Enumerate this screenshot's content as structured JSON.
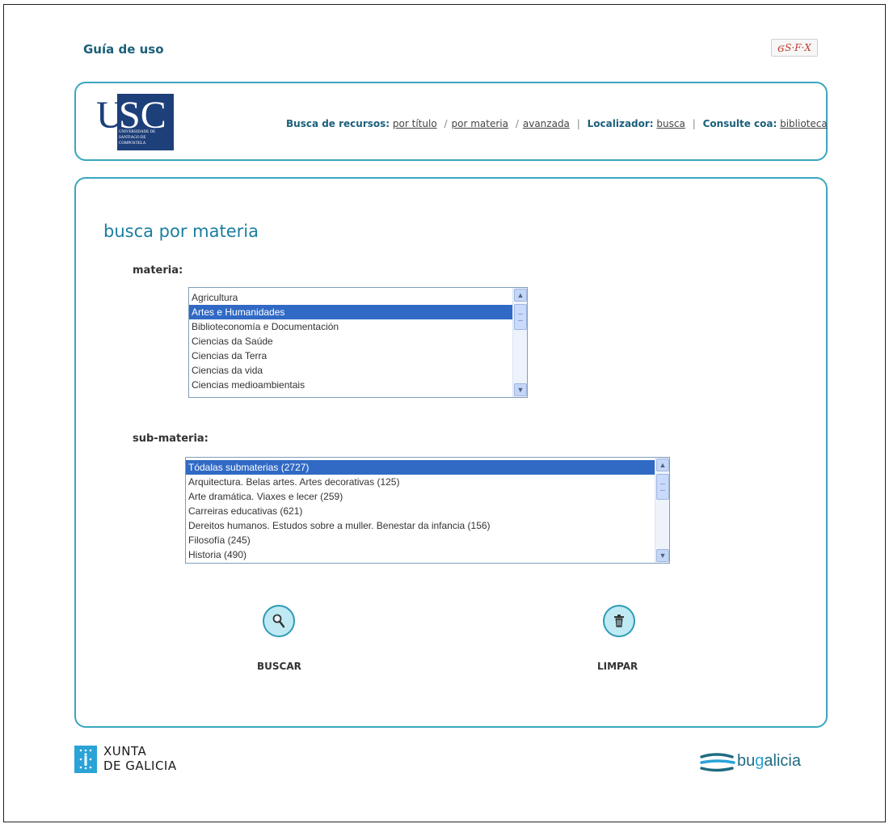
{
  "top": {
    "guide_label": "Guía de uso",
    "sfx_label": "S·F·X"
  },
  "header": {
    "logo_letters": "USC",
    "logo_subtext": "UNIVERSIDADE DE SANTIAGO DE COMPOSTELA",
    "nav": {
      "resources_label": "Busca de recursos:",
      "by_title": "por título",
      "by_subject": "por materia",
      "advanced": "avanzada",
      "locator_label": "Localizador:",
      "locator_link": "busca",
      "consult_label": "Consulte coa:",
      "library_link": "biblioteca",
      "slash": "/",
      "pipe": "|"
    }
  },
  "main": {
    "title": "busca por materia",
    "subject_label": "materia:",
    "subject_items": [
      "Agricultura",
      "Artes e Humanidades",
      "Biblioteconomía e Documentación",
      "Ciencias da Saúde",
      "Ciencias da Terra",
      "Ciencias da vida",
      "Ciencias medioambientais"
    ],
    "subject_selected": "Artes e Humanidades",
    "subsubject_label": "sub-materia:",
    "subsubject_items": [
      "Tódalas submaterias (2727)",
      "Arquitectura. Belas artes. Artes decorativas (125)",
      "Arte dramática. Viaxes e lecer (259)",
      "Carreiras educativas (621)",
      "Dereitos humanos. Estudos sobre a muller. Benestar da infancia (156)",
      "Filosofía (245)",
      "Historia (490)"
    ],
    "subsubject_selected": "Tódalas submaterias (2727)",
    "search_button": "BUSCAR",
    "clear_button": "LIMPAR"
  },
  "footer": {
    "xunta_line1": "XUNTA",
    "xunta_line2": "DE GALICIA",
    "bug_prefix": "bu",
    "bug_mid": "g",
    "bug_suffix": "alicia"
  },
  "colors": {
    "accent": "#3aa6bf",
    "title": "#1a7ea0",
    "selection": "#316ac5",
    "logo_blue": "#1d3f7a"
  }
}
